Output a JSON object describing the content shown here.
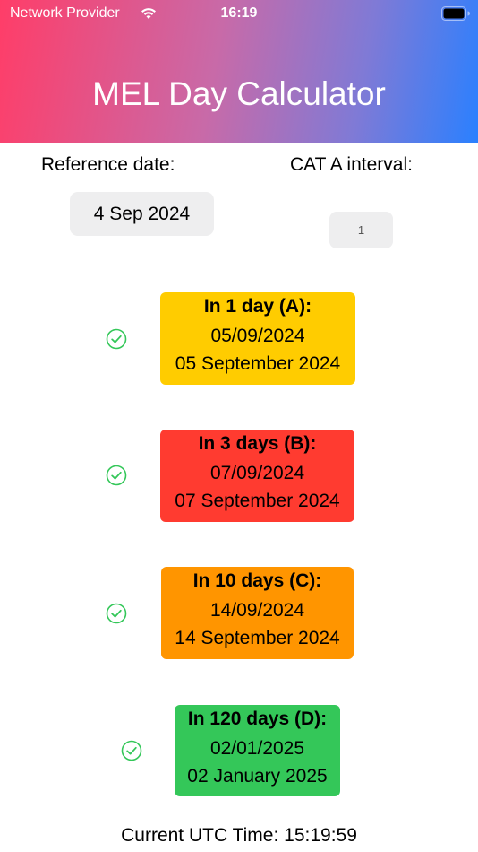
{
  "status_bar": {
    "carrier": "Network Provider",
    "time": "16:19"
  },
  "header": {
    "title": "MEL Day Calculator",
    "gradient_start": "#ff3d68",
    "gradient_end": "#2a80ff"
  },
  "reference": {
    "label": "Reference date:",
    "value": "4 Sep 2024"
  },
  "cat_a": {
    "label": "CAT A interval:",
    "value": "1"
  },
  "results": [
    {
      "title": "In 1 day (A):",
      "short": "05/09/2024",
      "long": "05 September 2024",
      "color": "#ffcc00",
      "checked": true
    },
    {
      "title": "In 3 days (B):",
      "short": "07/09/2024",
      "long": "07 September 2024",
      "color": "#ff3b30",
      "checked": true
    },
    {
      "title": "In 10 days (C):",
      "short": "14/09/2024",
      "long": "14 September 2024",
      "color": "#ff9500",
      "checked": true
    },
    {
      "title": "In 120 days (D):",
      "short": "02/01/2025",
      "long": "02 January 2025",
      "color": "#34c759",
      "checked": true
    }
  ],
  "utc": {
    "text": "Current UTC Time: 15:19:59"
  },
  "icons": {
    "check": "checkmark-circle-icon",
    "wifi": "wifi-icon",
    "battery": "battery-icon"
  }
}
